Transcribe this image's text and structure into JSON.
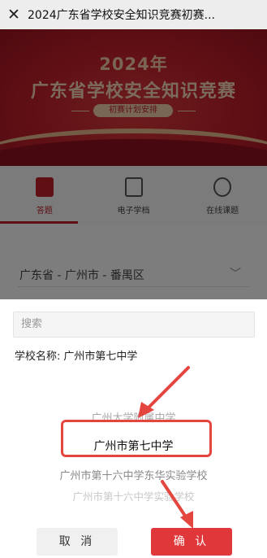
{
  "window": {
    "title": "2024广东省学校安全知识竞赛初赛..."
  },
  "banner": {
    "year": "2024年",
    "headline": "广东省学校安全知识竞赛",
    "subtitle": "初赛计划安排"
  },
  "nav": {
    "items": [
      {
        "label": "答题"
      },
      {
        "label": "电子学档"
      },
      {
        "label": "在线课题"
      }
    ]
  },
  "region": {
    "value": "广东省 - 广州市 - 番禺区"
  },
  "search": {
    "placeholder": "搜索"
  },
  "school": {
    "label": "学校名称:",
    "value": "广州市第七中学"
  },
  "picker": {
    "options": [
      "广州大学附属中学",
      "广州市第七中学",
      "广州市第十六中学东华实验学校",
      "广州市第十六中学实验学校"
    ]
  },
  "buttons": {
    "cancel": "取 消",
    "confirm": "确 认"
  },
  "colors": {
    "accent": "#e0383a",
    "banner": "#c0202a",
    "highlight": "#e5453f"
  },
  "icons": [
    "close-icon",
    "chevron-down-icon",
    "quiz-icon",
    "e-file-icon",
    "online-course-icon",
    "arrow-annotation-icon"
  ]
}
